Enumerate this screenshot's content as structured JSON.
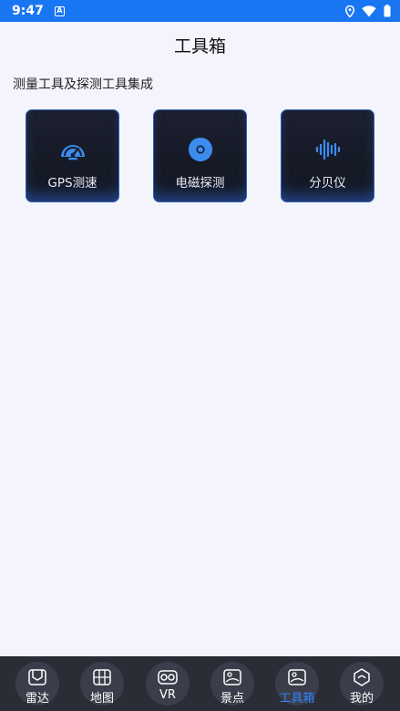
{
  "status_bar": {
    "time": "9:47",
    "app_badge": "A",
    "icons": [
      "location-icon",
      "wifi-icon",
      "battery-icon"
    ]
  },
  "header": {
    "title": "工具箱"
  },
  "section": {
    "subtitle": "测量工具及探测工具集成"
  },
  "tools": [
    {
      "label": "GPS测速",
      "icon": "speedometer-icon"
    },
    {
      "label": "电磁探测",
      "icon": "radiation-icon"
    },
    {
      "label": "分贝仪",
      "icon": "sound-wave-icon"
    }
  ],
  "nav": {
    "active": "工具箱",
    "items": [
      {
        "label": "雷达",
        "icon": "radar-icon"
      },
      {
        "label": "地图",
        "icon": "map-icon"
      },
      {
        "label": "VR",
        "icon": "vr-glasses-icon"
      },
      {
        "label": "景点",
        "icon": "scenery-icon"
      },
      {
        "label": "工具箱",
        "icon": "toolbox-icon"
      },
      {
        "label": "我的",
        "icon": "profile-icon"
      }
    ]
  },
  "colors": {
    "status_bar": "#1976f2",
    "accent": "#2f86ff",
    "card_bg": "#171b28",
    "nav_bg": "#2a2c36",
    "page_bg": "#f3f4fc"
  }
}
